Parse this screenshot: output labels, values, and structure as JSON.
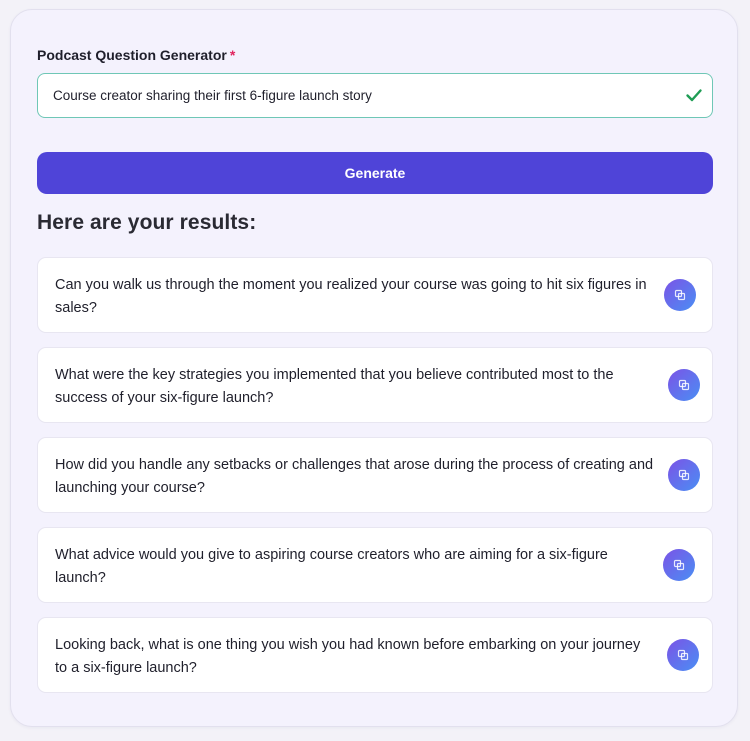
{
  "form": {
    "label": "Podcast Question Generator",
    "required_mark": "*",
    "topic_value": "Course creator sharing their first 6-figure launch story",
    "generate_label": "Generate"
  },
  "results": {
    "heading": "Here are your results:",
    "items": [
      {
        "text": "Can you walk us through the moment you realized your course was going to hit six figures in sales?"
      },
      {
        "text": "What were the key strategies you implemented that you believe contributed most to the success of your six-figure launch?"
      },
      {
        "text": "How did you handle any setbacks or challenges that arose during the process of creating and launching your course?"
      },
      {
        "text": "What advice would you give to aspiring course creators who are aiming for a six-figure launch?"
      },
      {
        "text": "Looking back, what is one thing you wish you had known before embarking on your journey to a six-figure launch?"
      }
    ]
  },
  "icons": {
    "valid": "check-icon",
    "copy": "copy-icon"
  },
  "colors": {
    "primary": "#4f44d8",
    "required": "#e0245e",
    "valid": "#1f9d55",
    "input_border": "#6fc7b6",
    "copy_gradient_start": "#7b53e6",
    "copy_gradient_end": "#4a8ff4"
  }
}
